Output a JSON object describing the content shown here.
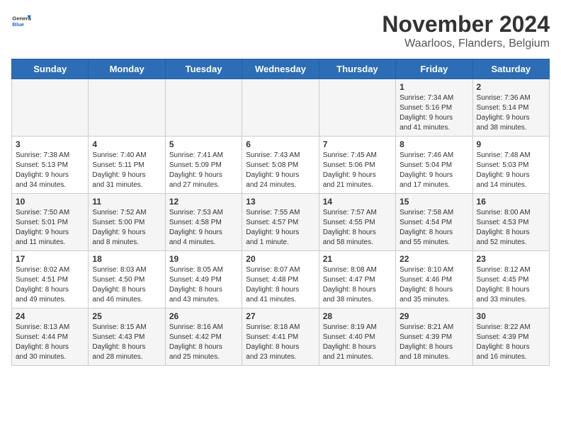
{
  "logo": {
    "general": "General",
    "blue": "Blue"
  },
  "header": {
    "month": "November 2024",
    "location": "Waarloos, Flanders, Belgium"
  },
  "weekdays": [
    "Sunday",
    "Monday",
    "Tuesday",
    "Wednesday",
    "Thursday",
    "Friday",
    "Saturday"
  ],
  "weeks": [
    [
      {
        "day": "",
        "info": ""
      },
      {
        "day": "",
        "info": ""
      },
      {
        "day": "",
        "info": ""
      },
      {
        "day": "",
        "info": ""
      },
      {
        "day": "",
        "info": ""
      },
      {
        "day": "1",
        "info": "Sunrise: 7:34 AM\nSunset: 5:16 PM\nDaylight: 9 hours\nand 41 minutes."
      },
      {
        "day": "2",
        "info": "Sunrise: 7:36 AM\nSunset: 5:14 PM\nDaylight: 9 hours\nand 38 minutes."
      }
    ],
    [
      {
        "day": "3",
        "info": "Sunrise: 7:38 AM\nSunset: 5:13 PM\nDaylight: 9 hours\nand 34 minutes."
      },
      {
        "day": "4",
        "info": "Sunrise: 7:40 AM\nSunset: 5:11 PM\nDaylight: 9 hours\nand 31 minutes."
      },
      {
        "day": "5",
        "info": "Sunrise: 7:41 AM\nSunset: 5:09 PM\nDaylight: 9 hours\nand 27 minutes."
      },
      {
        "day": "6",
        "info": "Sunrise: 7:43 AM\nSunset: 5:08 PM\nDaylight: 9 hours\nand 24 minutes."
      },
      {
        "day": "7",
        "info": "Sunrise: 7:45 AM\nSunset: 5:06 PM\nDaylight: 9 hours\nand 21 minutes."
      },
      {
        "day": "8",
        "info": "Sunrise: 7:46 AM\nSunset: 5:04 PM\nDaylight: 9 hours\nand 17 minutes."
      },
      {
        "day": "9",
        "info": "Sunrise: 7:48 AM\nSunset: 5:03 PM\nDaylight: 9 hours\nand 14 minutes."
      }
    ],
    [
      {
        "day": "10",
        "info": "Sunrise: 7:50 AM\nSunset: 5:01 PM\nDaylight: 9 hours\nand 11 minutes."
      },
      {
        "day": "11",
        "info": "Sunrise: 7:52 AM\nSunset: 5:00 PM\nDaylight: 9 hours\nand 8 minutes."
      },
      {
        "day": "12",
        "info": "Sunrise: 7:53 AM\nSunset: 4:58 PM\nDaylight: 9 hours\nand 4 minutes."
      },
      {
        "day": "13",
        "info": "Sunrise: 7:55 AM\nSunset: 4:57 PM\nDaylight: 9 hours\nand 1 minute."
      },
      {
        "day": "14",
        "info": "Sunrise: 7:57 AM\nSunset: 4:55 PM\nDaylight: 8 hours\nand 58 minutes."
      },
      {
        "day": "15",
        "info": "Sunrise: 7:58 AM\nSunset: 4:54 PM\nDaylight: 8 hours\nand 55 minutes."
      },
      {
        "day": "16",
        "info": "Sunrise: 8:00 AM\nSunset: 4:53 PM\nDaylight: 8 hours\nand 52 minutes."
      }
    ],
    [
      {
        "day": "17",
        "info": "Sunrise: 8:02 AM\nSunset: 4:51 PM\nDaylight: 8 hours\nand 49 minutes."
      },
      {
        "day": "18",
        "info": "Sunrise: 8:03 AM\nSunset: 4:50 PM\nDaylight: 8 hours\nand 46 minutes."
      },
      {
        "day": "19",
        "info": "Sunrise: 8:05 AM\nSunset: 4:49 PM\nDaylight: 8 hours\nand 43 minutes."
      },
      {
        "day": "20",
        "info": "Sunrise: 8:07 AM\nSunset: 4:48 PM\nDaylight: 8 hours\nand 41 minutes."
      },
      {
        "day": "21",
        "info": "Sunrise: 8:08 AM\nSunset: 4:47 PM\nDaylight: 8 hours\nand 38 minutes."
      },
      {
        "day": "22",
        "info": "Sunrise: 8:10 AM\nSunset: 4:46 PM\nDaylight: 8 hours\nand 35 minutes."
      },
      {
        "day": "23",
        "info": "Sunrise: 8:12 AM\nSunset: 4:45 PM\nDaylight: 8 hours\nand 33 minutes."
      }
    ],
    [
      {
        "day": "24",
        "info": "Sunrise: 8:13 AM\nSunset: 4:44 PM\nDaylight: 8 hours\nand 30 minutes."
      },
      {
        "day": "25",
        "info": "Sunrise: 8:15 AM\nSunset: 4:43 PM\nDaylight: 8 hours\nand 28 minutes."
      },
      {
        "day": "26",
        "info": "Sunrise: 8:16 AM\nSunset: 4:42 PM\nDaylight: 8 hours\nand 25 minutes."
      },
      {
        "day": "27",
        "info": "Sunrise: 8:18 AM\nSunset: 4:41 PM\nDaylight: 8 hours\nand 23 minutes."
      },
      {
        "day": "28",
        "info": "Sunrise: 8:19 AM\nSunset: 4:40 PM\nDaylight: 8 hours\nand 21 minutes."
      },
      {
        "day": "29",
        "info": "Sunrise: 8:21 AM\nSunset: 4:39 PM\nDaylight: 8 hours\nand 18 minutes."
      },
      {
        "day": "30",
        "info": "Sunrise: 8:22 AM\nSunset: 4:39 PM\nDaylight: 8 hours\nand 16 minutes."
      }
    ]
  ]
}
